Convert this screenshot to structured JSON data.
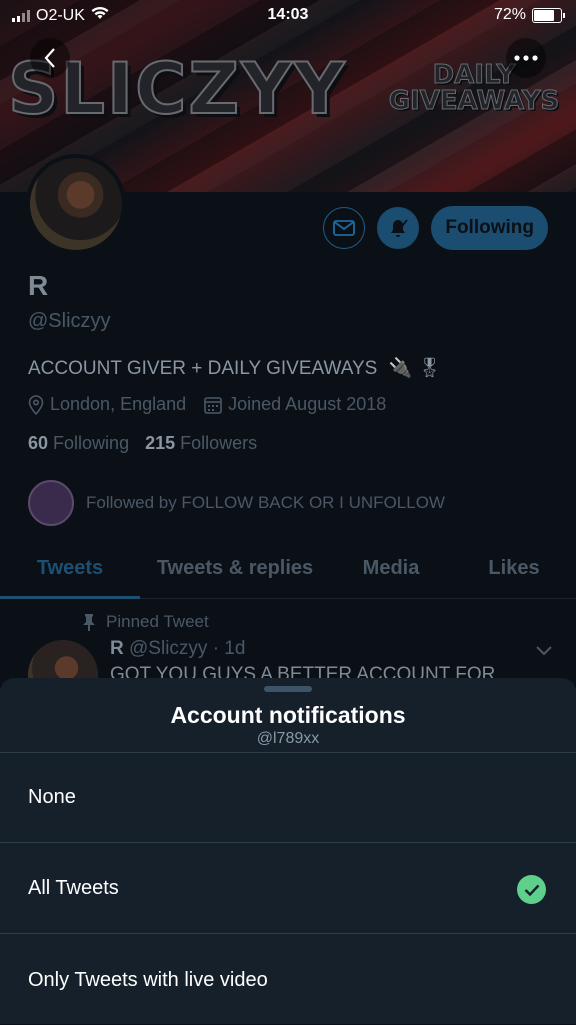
{
  "status_bar": {
    "carrier": "O2-UK",
    "time": "14:03",
    "battery": "72%"
  },
  "banner": {
    "title": "SLICZYY",
    "subtitle_line1": "DAILY",
    "subtitle_line2": "GIVEAWAYS"
  },
  "profile": {
    "name": "R",
    "handle": "@Sliczyy",
    "bio": "ACCOUNT GIVER + DAILY GIVEAWAYS",
    "location": "London, England",
    "joined": "Joined August 2018",
    "following_count": "60",
    "following_label": "Following",
    "followers_count": "215",
    "followers_label": "Followers",
    "followed_by": "Followed by FOLLOW BACK OR I UNFOLLOW"
  },
  "actions": {
    "following_button": "Following"
  },
  "tabs": [
    {
      "label": "Tweets"
    },
    {
      "label": "Tweets & replies"
    },
    {
      "label": "Media"
    },
    {
      "label": "Likes"
    }
  ],
  "pinned_tweet": {
    "label": "Pinned Tweet",
    "name": "R",
    "handle_time": "@Sliczyy · 1d",
    "text": "GOT YOU GUYS A BETTER ACCOUNT FOR"
  },
  "sheet": {
    "title": "Account notifications",
    "subtitle": "@l789xx",
    "options": [
      {
        "label": "None",
        "selected": false
      },
      {
        "label": "All Tweets",
        "selected": true
      },
      {
        "label": "Only Tweets with live video",
        "selected": false
      }
    ]
  },
  "colors": {
    "accent": "#1DA1F2",
    "check": "#5fd08b",
    "sheet_bg": "#15202b"
  }
}
